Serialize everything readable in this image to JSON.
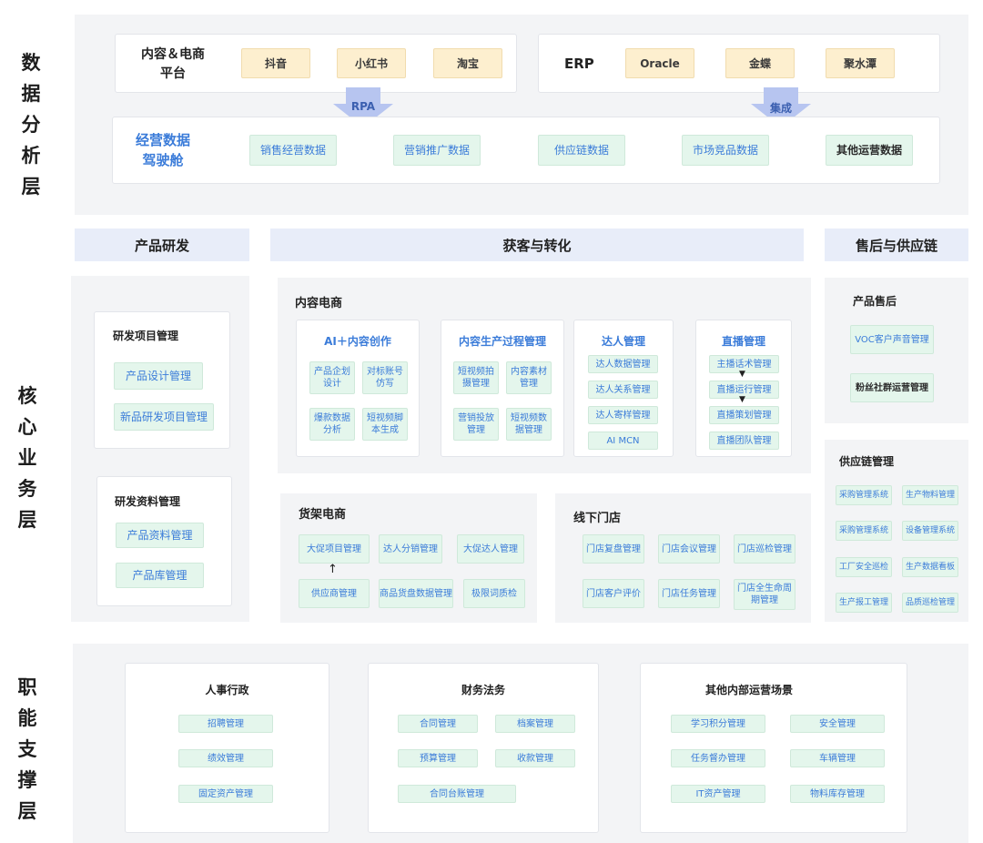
{
  "layers": {
    "data_analysis": [
      "数",
      "据",
      "分",
      "析",
      "层"
    ],
    "core_business": [
      "核",
      "心",
      "业",
      "务",
      "层"
    ],
    "function_support": [
      "职",
      "能",
      "支",
      "撑",
      "层"
    ]
  },
  "top": {
    "platform_title_1": "内容＆电商",
    "platform_title_2": "平台",
    "platforms": [
      "抖音",
      "小红书",
      "淘宝"
    ],
    "erp_title": "ERP",
    "erp_items": [
      "Oracle",
      "金蝶",
      "聚水潭"
    ],
    "arrow_rpa": "RPA",
    "arrow_integrate": "集成",
    "cockpit_1": "经营数据",
    "cockpit_2": "驾驶舱",
    "data_items": [
      "销售经营数据",
      "营销推广数据",
      "供应链数据",
      "市场竞品数据",
      "其他运营数据"
    ]
  },
  "headers": {
    "rd": "产品研发",
    "acquire": "获客与转化",
    "after": "售后与供应链"
  },
  "rd": {
    "proj_title": "研发项目管理",
    "proj_items": [
      "产品设计管理",
      "新品研发项目管理"
    ],
    "data_title": "研发资料管理",
    "data_items": [
      "产品资料管理",
      "产品库管理"
    ]
  },
  "content": {
    "title": "内容电商",
    "ai_title": "AI＋内容创作",
    "ai_items": [
      "产品企划\n设计",
      "对标账号\n仿写",
      "爆款数据\n分析",
      "短视频脚\n本生成"
    ],
    "prod_title": "内容生产过程管理",
    "prod_items": [
      "短视频拍\n摄管理",
      "内容素材\n管理",
      "营销投放\n管理",
      "短视频数\n据管理"
    ],
    "kol_title": "达人管理",
    "kol_items": [
      "达人数据管理",
      "达人关系管理",
      "达人寄样管理",
      "AI MCN"
    ],
    "live_title": "直播管理",
    "live_items": [
      "主播话术管理",
      "直播运行管理",
      "直播策划管理",
      "直播团队管理"
    ]
  },
  "shelf": {
    "title": "货架电商",
    "items": [
      "大促项目管理",
      "达人分销管理",
      "大促达人管理",
      "供应商管理",
      "商品货盘数据管理",
      "极限词质检"
    ]
  },
  "offline": {
    "title": "线下门店",
    "items": [
      "门店复盘管理",
      "门店会议管理",
      "门店巡检管理",
      "门店客户评价",
      "门店任务管理",
      "门店全生命周\n期管理"
    ]
  },
  "after": {
    "title": "产品售后",
    "items": [
      "VOC客户声音管理",
      "粉丝社群运营管理"
    ]
  },
  "supply": {
    "title": "供应链管理",
    "items": [
      "采购管理系统",
      "生产物料管理",
      "采购管理系统",
      "设备管理系统",
      "工厂安全巡检",
      "生产数据看板",
      "生产报工管理",
      "品质巡检管理"
    ]
  },
  "hr": {
    "title": "人事行政",
    "items": [
      "招聘管理",
      "绩效管理",
      "固定资产管理"
    ]
  },
  "finance": {
    "title": "财务法务",
    "items": [
      "合同管理",
      "档案管理",
      "预算管理",
      "收款管理",
      "合同台账管理"
    ]
  },
  "ops": {
    "title": "其他内部运营场景",
    "items": [
      "学习积分管理",
      "安全管理",
      "任务督办管理",
      "车辆管理",
      "IT资产管理",
      "物料库存管理"
    ]
  },
  "colors": {
    "header_bg": "#e8edf9",
    "green_box": "#e4f6ec",
    "yellow_box": "#fdefcf",
    "accent": "#3b7cd9",
    "arrow": "#b7c5f0"
  }
}
